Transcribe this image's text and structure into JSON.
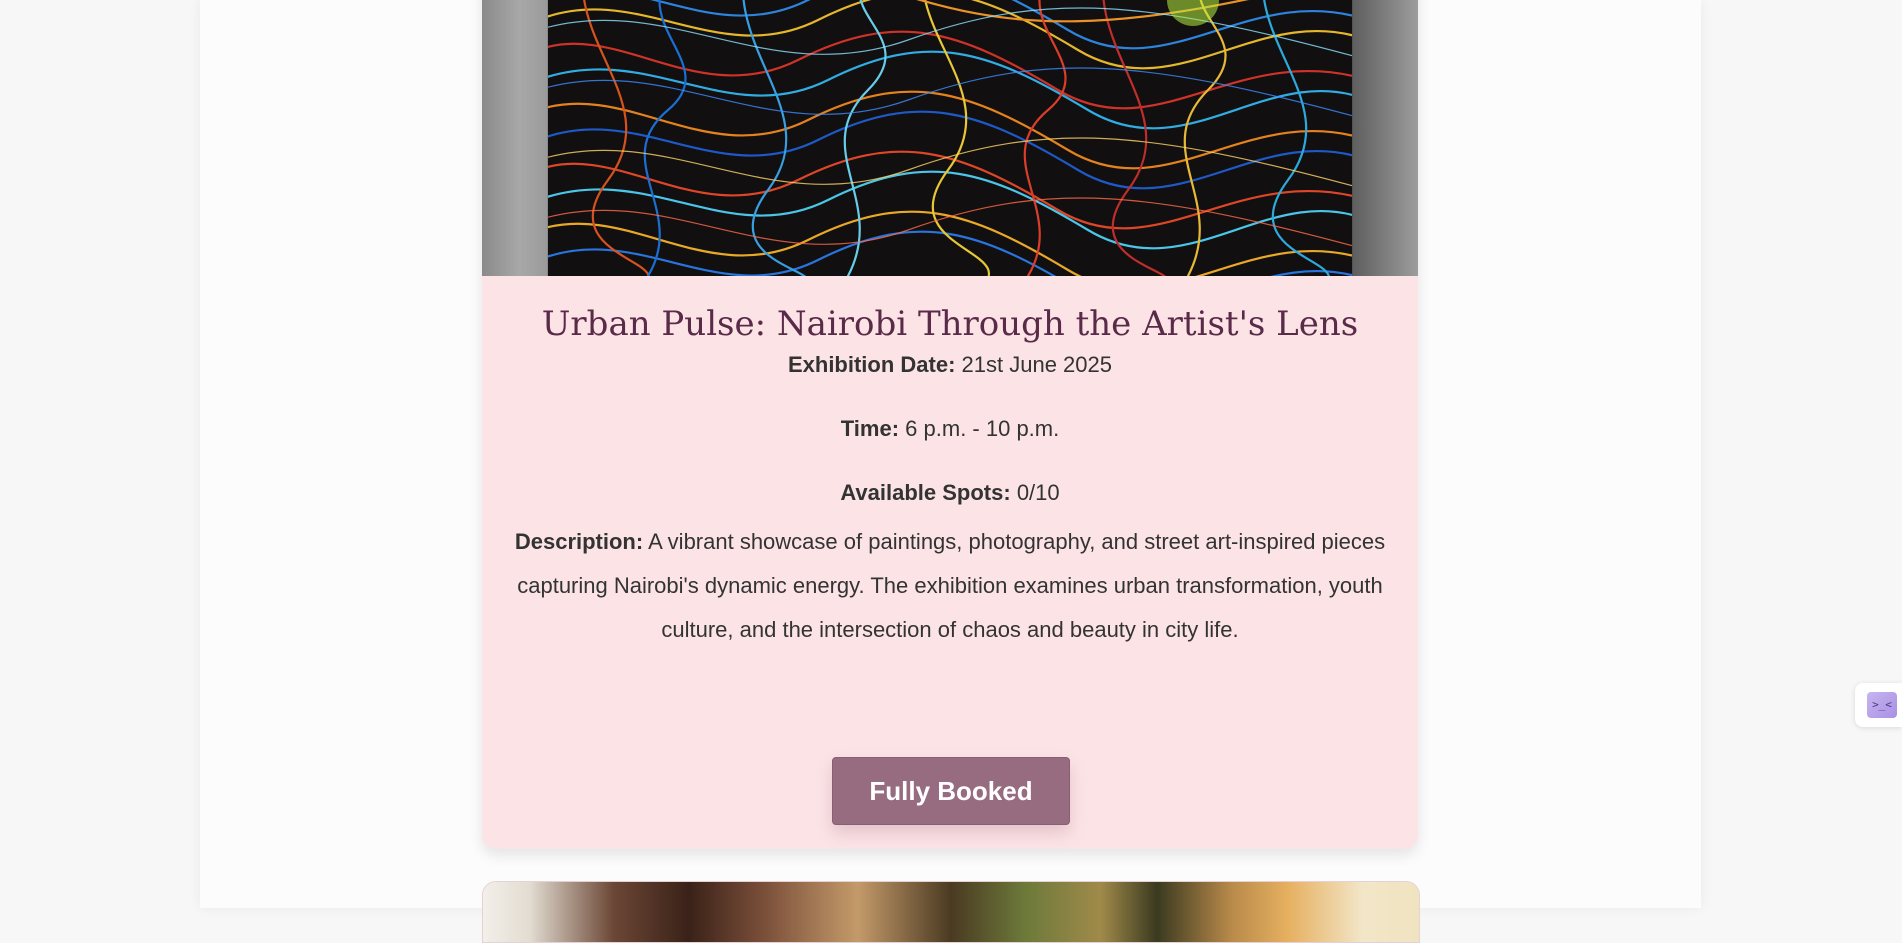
{
  "event": {
    "title": "Urban Pulse: Nairobi Through the Artist's Lens",
    "date_label": "Exhibition Date:",
    "date_value": "21st June 2025",
    "time_label": "Time:",
    "time_value": "6 p.m. - 10 p.m.",
    "spots_label": "Available Spots:",
    "spots_value": "0/10",
    "description_label": "Description:",
    "description_value": "A vibrant showcase of paintings, photography, and street art-inspired pieces capturing Nairobi's dynamic energy. The exhibition examines urban transformation, youth culture, and the intersection of chaos and beauty in city life.",
    "button_label": "Fully Booked"
  },
  "side_widget": {
    "icon": "code-icon",
    "glyph": ">_<"
  },
  "colors": {
    "card_background": "#fce4e6",
    "title_color": "#5a2a49",
    "button_background": "#986c80",
    "button_text": "#ffffff",
    "page_background": "#fcfcfc"
  }
}
